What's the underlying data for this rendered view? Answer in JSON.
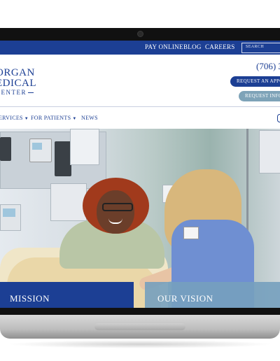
{
  "topbar": {
    "links": [
      "PAY ONLINE",
      "BLOG",
      "CAREERS"
    ],
    "search_placeholder": "SEARCH"
  },
  "logo": {
    "line1": "ORGAN",
    "line2": "EDICAL",
    "line3": "CENTER"
  },
  "header": {
    "phone": "(706) 3",
    "request_appointment": "REQUEST AN APPO",
    "request_info": "REQUEST INFO"
  },
  "nav": {
    "items": [
      "ERVICES",
      "FOR PATIENTS",
      "NEWS"
    ]
  },
  "hero": {
    "image": "patient-and-nurse-photo"
  },
  "cards": {
    "mission": "MISSION",
    "vision": "OUR VISION"
  },
  "colors": {
    "brand_blue": "#1c3f94",
    "light_teal": "#7ea3b8",
    "vision_blue": "#76a0be"
  }
}
